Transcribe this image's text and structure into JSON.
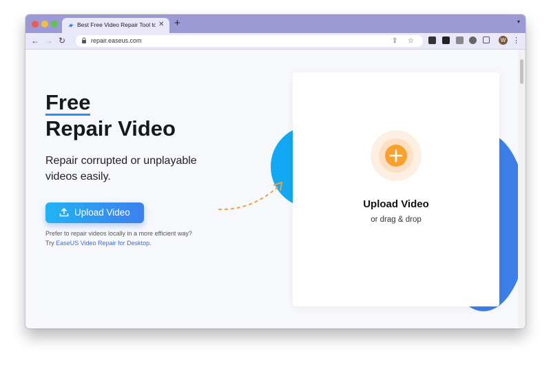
{
  "browser": {
    "tab_title": "Best Free Video Repair Tool to",
    "url": "repair.easeus.com",
    "avatar_initial": "W",
    "accent_color": "#9b9ad4"
  },
  "hero": {
    "title_line1": "Free",
    "title_line2": "Repair Video",
    "subtitle": "Repair corrupted or unplayable videos easily.",
    "upload_button": "Upload Video",
    "note_text": "Prefer to repair videos locally in a more efficient way?",
    "note_try": "Try",
    "note_link": "EaseUS Video Repair for Desktop",
    "note_end": "."
  },
  "upload_card": {
    "title": "Upload Video",
    "subtitle": "or drag & drop"
  },
  "icons": {
    "upload": "upload-icon",
    "plus": "plus-icon"
  }
}
